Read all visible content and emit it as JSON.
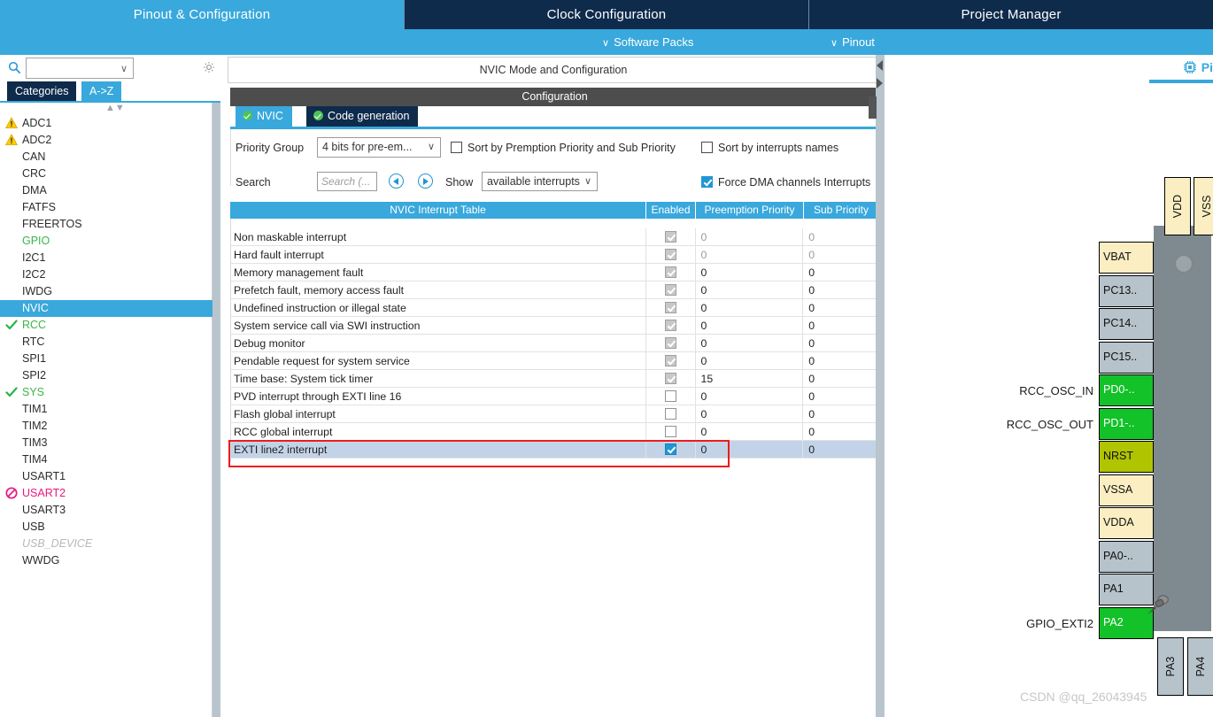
{
  "topbar": {
    "tabs": [
      {
        "label": "Pinout & Configuration",
        "active": true
      },
      {
        "label": "Clock Configuration",
        "active": false
      },
      {
        "label": "Project Manager",
        "active": false
      }
    ]
  },
  "secondbar": {
    "software_packs": "Software Packs",
    "pinout": "Pinout",
    "chevron": "∨"
  },
  "sidebar": {
    "search": {
      "value": "",
      "placeholder": ""
    },
    "gear_icon": "gear-icon",
    "tabs": [
      {
        "label": "Categories",
        "active": true
      },
      {
        "label": "A->Z",
        "active": false
      }
    ],
    "items": [
      {
        "label": "ADC1",
        "state": "warning"
      },
      {
        "label": "ADC2",
        "state": "warning"
      },
      {
        "label": "CAN",
        "state": "none"
      },
      {
        "label": "CRC",
        "state": "none"
      },
      {
        "label": "DMA",
        "state": "none"
      },
      {
        "label": "FATFS",
        "state": "none"
      },
      {
        "label": "FREERTOS",
        "state": "none"
      },
      {
        "label": "GPIO",
        "state": "configured"
      },
      {
        "label": "I2C1",
        "state": "none"
      },
      {
        "label": "I2C2",
        "state": "none"
      },
      {
        "label": "IWDG",
        "state": "none"
      },
      {
        "label": "NVIC",
        "state": "selected"
      },
      {
        "label": "RCC",
        "state": "ok"
      },
      {
        "label": "RTC",
        "state": "none"
      },
      {
        "label": "SPI1",
        "state": "none"
      },
      {
        "label": "SPI2",
        "state": "none"
      },
      {
        "label": "SYS",
        "state": "ok"
      },
      {
        "label": "TIM1",
        "state": "none"
      },
      {
        "label": "TIM2",
        "state": "none"
      },
      {
        "label": "TIM3",
        "state": "none"
      },
      {
        "label": "TIM4",
        "state": "none"
      },
      {
        "label": "USART1",
        "state": "none"
      },
      {
        "label": "USART2",
        "state": "conflict"
      },
      {
        "label": "USART3",
        "state": "none"
      },
      {
        "label": "USB",
        "state": "none"
      },
      {
        "label": "USB_DEVICE",
        "state": "disabled"
      },
      {
        "label": "WWDG",
        "state": "none"
      }
    ]
  },
  "config": {
    "mode_header": "NVIC Mode and Configuration",
    "section_title": "Configuration",
    "tabs": [
      {
        "label": "NVIC",
        "active": true
      },
      {
        "label": "Code generation",
        "active": false
      }
    ],
    "priority_group_label": "Priority Group",
    "priority_group_value": "4 bits for pre-em...",
    "sort_preemption_label": "Sort by Premption Priority and Sub Priority",
    "sort_preemption_checked": false,
    "sort_names_label": "Sort by interrupts names",
    "sort_names_checked": false,
    "search_label": "Search",
    "search_placeholder": "Search (...",
    "search_value": "",
    "show_label": "Show",
    "show_value": "available interrupts",
    "force_dma_label": "Force DMA channels Interrupts",
    "force_dma_checked": true,
    "prev_icon": "prev-arrow-icon",
    "next_icon": "next-arrow-icon"
  },
  "table": {
    "headers": {
      "name": "NVIC Interrupt Table",
      "enabled": "Enabled",
      "preemption": "Preemption Priority",
      "sub": "Sub Priority"
    },
    "rows": [
      {
        "name": "Non maskable interrupt",
        "enabled": "readonly",
        "preemption": "0",
        "sub": "0",
        "dim": true,
        "highlight": false
      },
      {
        "name": "Hard fault interrupt",
        "enabled": "readonly",
        "preemption": "0",
        "sub": "0",
        "dim": true,
        "highlight": false
      },
      {
        "name": "Memory management fault",
        "enabled": "readonly",
        "preemption": "0",
        "sub": "0",
        "dim": false,
        "highlight": false
      },
      {
        "name": "Prefetch fault, memory access fault",
        "enabled": "readonly",
        "preemption": "0",
        "sub": "0",
        "dim": false,
        "highlight": false
      },
      {
        "name": "Undefined instruction or illegal state",
        "enabled": "readonly",
        "preemption": "0",
        "sub": "0",
        "dim": false,
        "highlight": false
      },
      {
        "name": "System service call via SWI instruction",
        "enabled": "readonly",
        "preemption": "0",
        "sub": "0",
        "dim": false,
        "highlight": false
      },
      {
        "name": "Debug monitor",
        "enabled": "readonly",
        "preemption": "0",
        "sub": "0",
        "dim": false,
        "highlight": false
      },
      {
        "name": "Pendable request for system service",
        "enabled": "readonly",
        "preemption": "0",
        "sub": "0",
        "dim": false,
        "highlight": false
      },
      {
        "name": "Time base: System tick timer",
        "enabled": "readonly",
        "preemption": "15",
        "sub": "0",
        "dim": false,
        "highlight": false
      },
      {
        "name": "PVD interrupt through EXTI line 16",
        "enabled": "off",
        "preemption": "0",
        "sub": "0",
        "dim": false,
        "highlight": false
      },
      {
        "name": "Flash global interrupt",
        "enabled": "off",
        "preemption": "0",
        "sub": "0",
        "dim": false,
        "highlight": false
      },
      {
        "name": "RCC global interrupt",
        "enabled": "off",
        "preemption": "0",
        "sub": "0",
        "dim": false,
        "highlight": false
      },
      {
        "name": "EXTI line2 interrupt",
        "enabled": "on",
        "preemption": "0",
        "sub": "0",
        "dim": false,
        "highlight": true
      }
    ]
  },
  "pinout": {
    "view_label": "Pi",
    "chip_icon": "chip-icon",
    "left_pins": [
      {
        "label": "VBAT",
        "kind": "pwr",
        "signal": ""
      },
      {
        "label": "PC13..",
        "kind": "io",
        "signal": ""
      },
      {
        "label": "PC14..",
        "kind": "io",
        "signal": ""
      },
      {
        "label": "PC15..",
        "kind": "io",
        "signal": ""
      },
      {
        "label": "PD0-..",
        "kind": "act",
        "signal": "RCC_OSC_IN"
      },
      {
        "label": "PD1-..",
        "kind": "act",
        "signal": "RCC_OSC_OUT"
      },
      {
        "label": "NRST",
        "kind": "rst",
        "signal": ""
      },
      {
        "label": "VSSA",
        "kind": "pwr",
        "signal": ""
      },
      {
        "label": "VDDA",
        "kind": "pwr",
        "signal": ""
      },
      {
        "label": "PA0-..",
        "kind": "io",
        "signal": ""
      },
      {
        "label": "PA1",
        "kind": "io",
        "signal": ""
      },
      {
        "label": "PA2",
        "kind": "act",
        "signal": "GPIO_EXTI2"
      }
    ],
    "top_pins": [
      {
        "label": "VDD",
        "kind": "pwr"
      },
      {
        "label": "VSS",
        "kind": "pwr"
      }
    ],
    "bottom_pins": [
      {
        "label": "PA3",
        "kind": "io"
      },
      {
        "label": "PA4",
        "kind": "io"
      }
    ],
    "pushpin_icon": "pushpin-icon"
  },
  "watermark": "CSDN @qq_26043945"
}
